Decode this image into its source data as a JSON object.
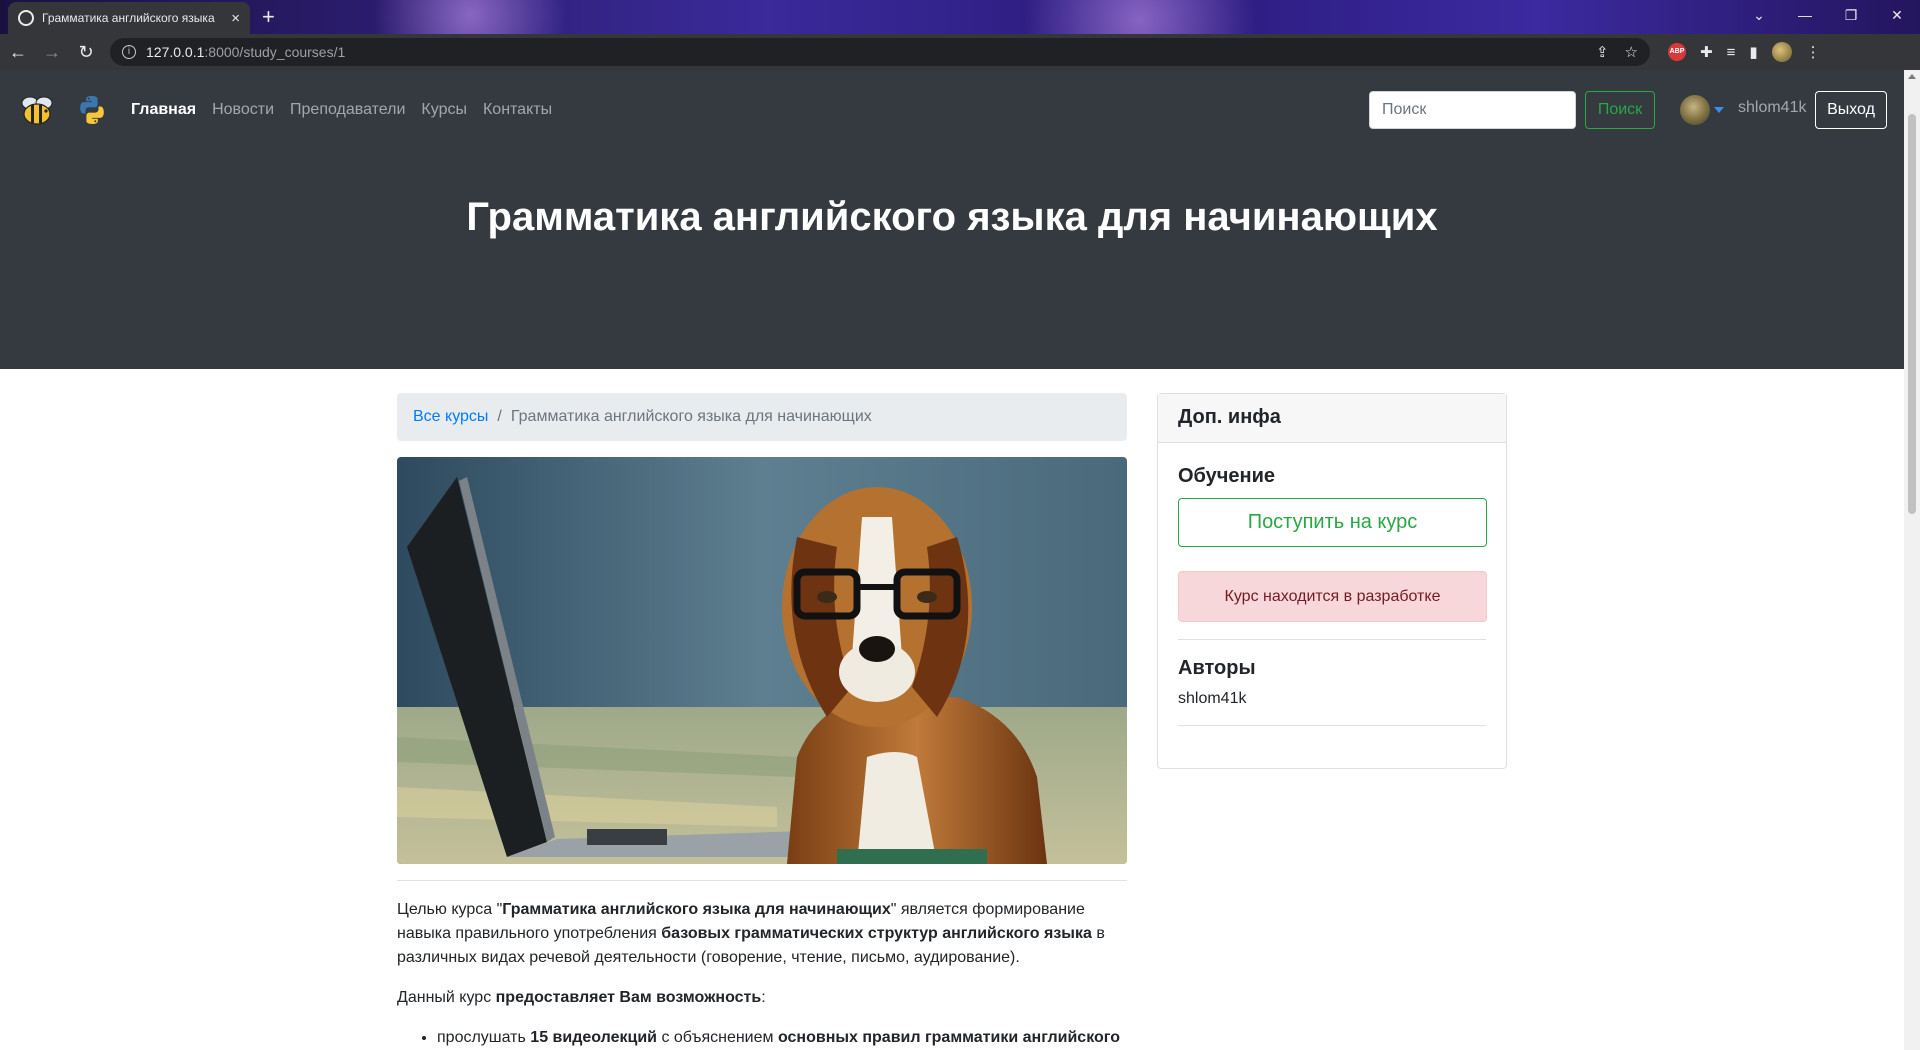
{
  "browser": {
    "tab_title": "Грамматика английского языка",
    "tab_close": "×",
    "new_tab": "+",
    "url_host": "127.0.0.1",
    "url_path": ":8000/study_courses/1",
    "window_controls": [
      "⌄",
      "—",
      "❐",
      "✕"
    ]
  },
  "navbar": {
    "menu": [
      {
        "label": "Главная",
        "active": true
      },
      {
        "label": "Новости",
        "active": false
      },
      {
        "label": "Преподаватели",
        "active": false
      },
      {
        "label": "Курсы",
        "active": false
      },
      {
        "label": "Контакты",
        "active": false
      }
    ],
    "search_placeholder": "Поиск",
    "search_button": "Поиск",
    "username": "shlom41k",
    "logout": "Выход"
  },
  "hero": {
    "title": "Грамматика английского языка для начинающих"
  },
  "breadcrumb": {
    "link": "Все курсы",
    "separator": "/",
    "current": "Грамматика английского языка для начинающих"
  },
  "description": {
    "p1_a": "Целью курса \"",
    "p1_b": "Грамматика английского языка для начинающих",
    "p1_c": "\" является формирование навыка правильного употребления ",
    "p1_d": "базовых грамматических структур английского языка",
    "p1_e": " в различных видах речевой деятельности (говорение, чтение, письмо, аудирование).",
    "p2_a": "Данный курс ",
    "p2_b": "предоставляет  Вам возможность",
    "p2_c": ":",
    "li1_a": "прослушать ",
    "li1_b": "15  видеолекций",
    "li1_c": " с объяснением ",
    "li1_d": "основных правил грамматики английского"
  },
  "sidebar": {
    "header": "Доп. инфа",
    "learning_title": "Обучение",
    "enroll_button": "Поступить на курс",
    "alert": "Курс находится в разработке",
    "authors_title": "Авторы",
    "author": "shlom41k"
  },
  "colors": {
    "navbar_bg": "#343a40",
    "success": "#28a745",
    "link": "#007bff",
    "alert_bg": "#f8d7da",
    "alert_text": "#721c24"
  }
}
